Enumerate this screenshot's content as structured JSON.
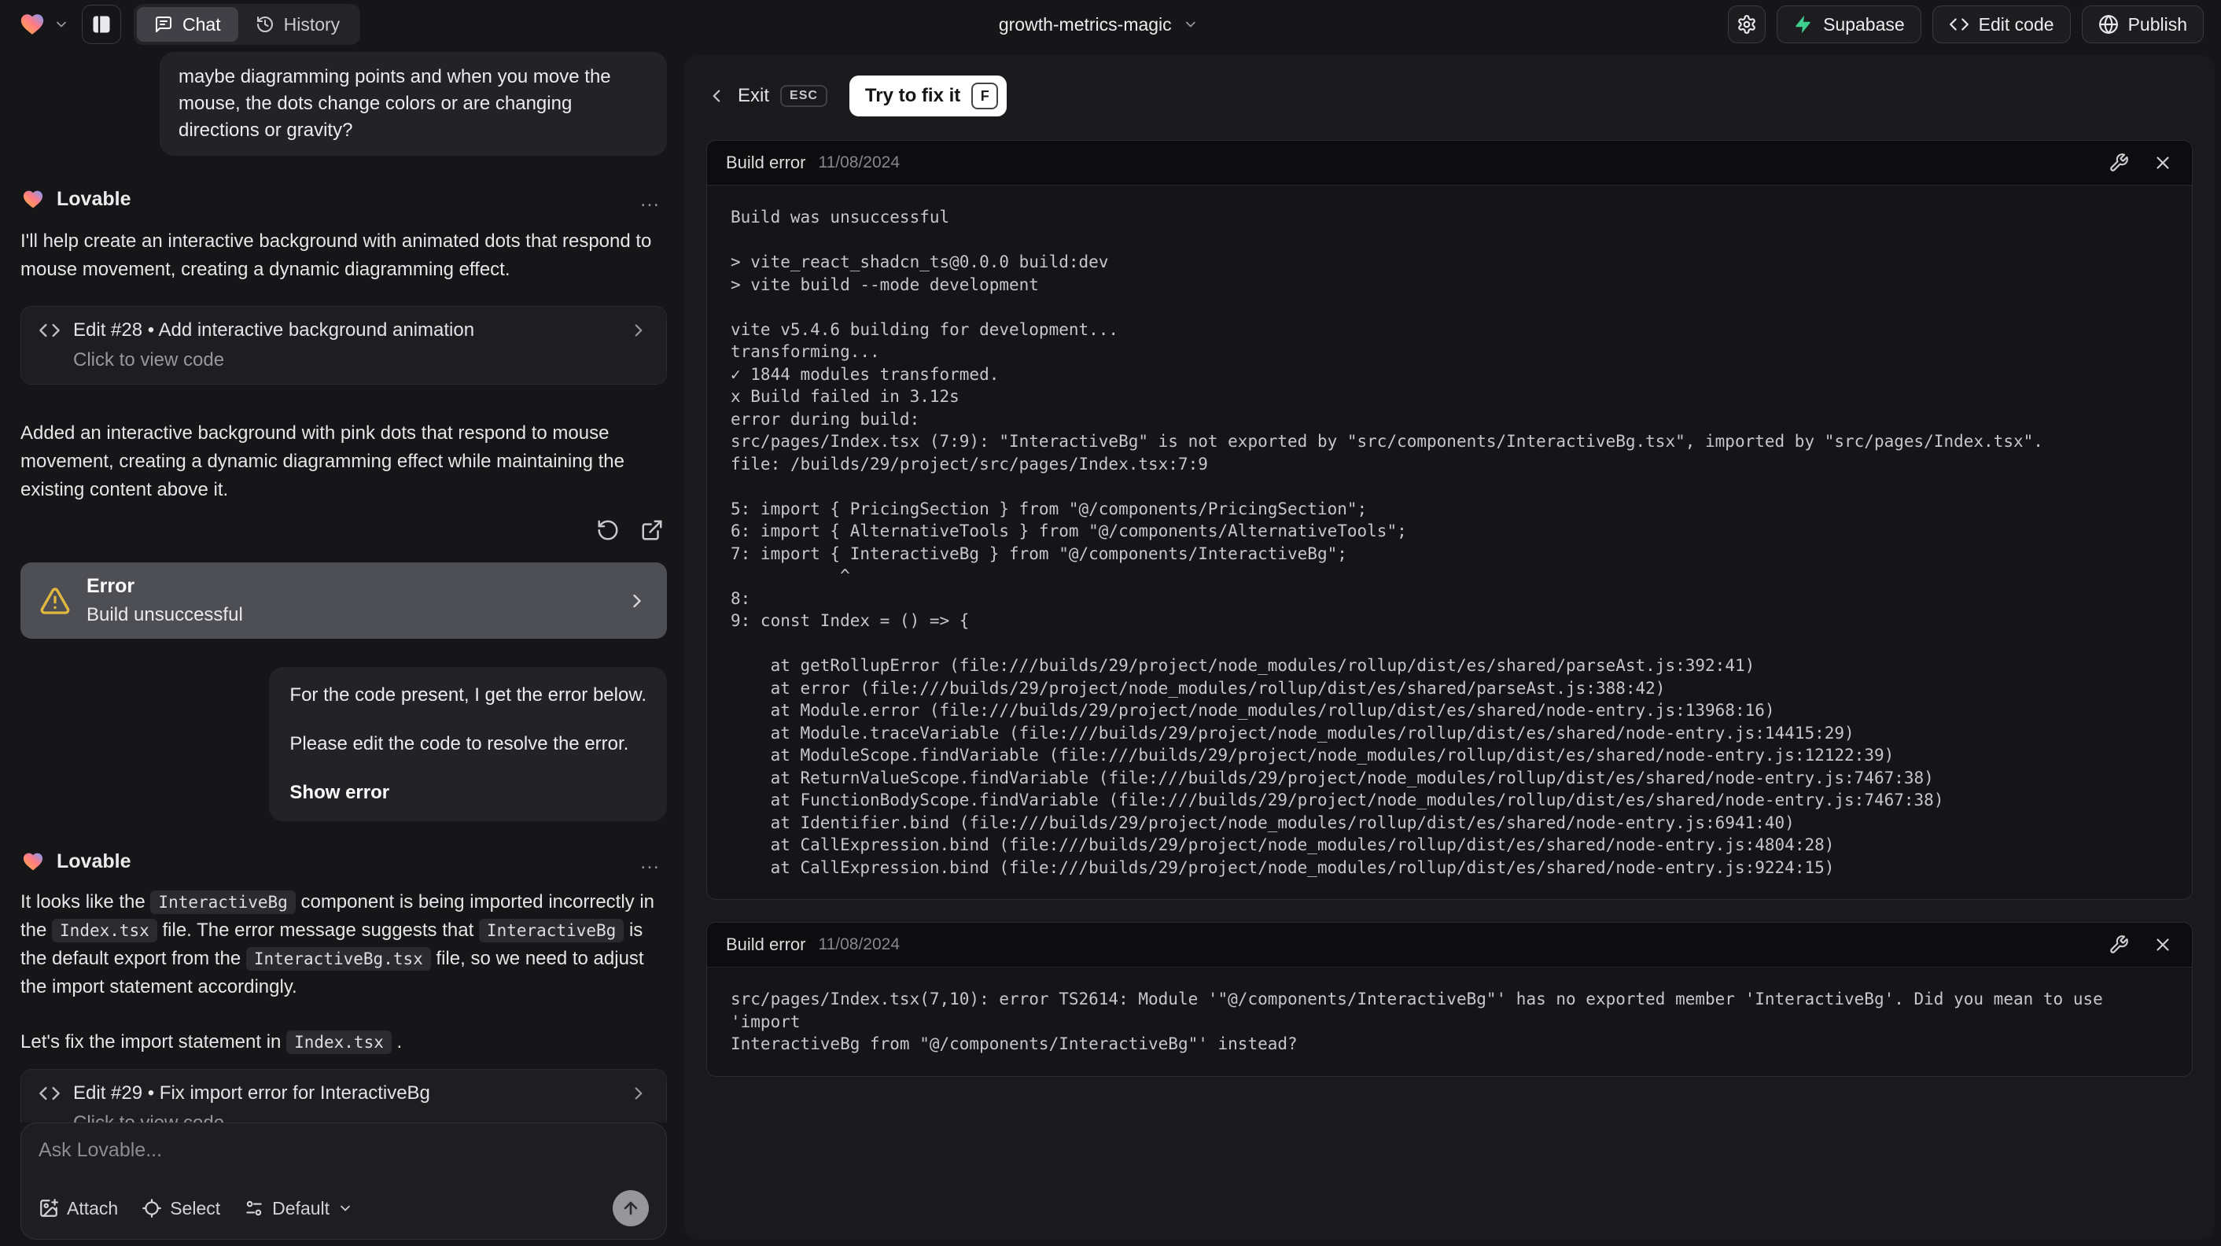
{
  "topbar": {
    "project": "growth-metrics-magic",
    "tab_chat": "Chat",
    "tab_history": "History",
    "btn_supabase": "Supabase",
    "btn_edit_code": "Edit code",
    "btn_publish": "Publish"
  },
  "colors": {
    "supabase_green": "#3ecf8e",
    "warning_amber": "#e2b93f",
    "error_card_bg": "#4e4e55",
    "try_fix_bg": "#ffffff"
  },
  "chat": {
    "assistant_name": "Lovable",
    "menu_ellipsis": "…",
    "user_msg_1": "maybe diagramming points and when you move the mouse, the dots change colors or are changing directions or gravity?",
    "assistant_msg_1": "I'll help create an interactive background with animated dots that respond to mouse movement, creating a dynamic diagramming effect.",
    "edit_card_1_title": "Edit #28 • Add interactive background animation",
    "edit_card_1_subtitle": "Click to view code",
    "assistant_msg_2": "Added an interactive background with pink dots that respond to mouse movement, creating a dynamic diagramming effect while maintaining the existing content above it.",
    "error_card_title": "Error",
    "error_card_subtitle": "Build unsuccessful",
    "user_msg_2_p1": "For the code present, I get the error below.",
    "user_msg_2_p2": "Please edit the code to resolve the error.",
    "user_msg_2_action": "Show error",
    "assistant_msg_3": {
      "s0": "It looks like the ",
      "c1": "InteractiveBg",
      "s2": " component is being imported incorrectly in the ",
      "c3": "Index.tsx",
      "s4": " file. The error message suggests that ",
      "c5": "InteractiveBg",
      "s6": " is the default export from the ",
      "c7": "InteractiveBg.tsx",
      "s8": " file, so we need to adjust the import statement accordingly."
    },
    "assistant_msg_4": {
      "s0": "Let's fix the import statement in ",
      "c1": "Index.tsx",
      "s2": " ."
    },
    "edit_card_2_title": "Edit #29 • Fix import error for InteractiveBg",
    "edit_card_2_subtitle": "Click to view code"
  },
  "composer": {
    "placeholder": "Ask Lovable...",
    "attach": "Attach",
    "select": "Select",
    "mode": "Default"
  },
  "fixbar": {
    "exit": "Exit",
    "esc": "ESC",
    "try_fix": "Try to fix it",
    "fkey": "F"
  },
  "panel1": {
    "title": "Build error",
    "date": "11/08/2024",
    "log": "Build was unsuccessful\n\n> vite_react_shadcn_ts@0.0.0 build:dev\n> vite build --mode development\n\nvite v5.4.6 building for development...\ntransforming...\n✓ 1844 modules transformed.\nx Build failed in 3.12s\nerror during build:\nsrc/pages/Index.tsx (7:9): \"InteractiveBg\" is not exported by \"src/components/InteractiveBg.tsx\", imported by \"src/pages/Index.tsx\".\nfile: /builds/29/project/src/pages/Index.tsx:7:9\n\n5: import { PricingSection } from \"@/components/PricingSection\";\n6: import { AlternativeTools } from \"@/components/AlternativeTools\";\n7: import { InteractiveBg } from \"@/components/InteractiveBg\";\n           ^\n8:\n9: const Index = () => {\n\n    at getRollupError (file:///builds/29/project/node_modules/rollup/dist/es/shared/parseAst.js:392:41)\n    at error (file:///builds/29/project/node_modules/rollup/dist/es/shared/parseAst.js:388:42)\n    at Module.error (file:///builds/29/project/node_modules/rollup/dist/es/shared/node-entry.js:13968:16)\n    at Module.traceVariable (file:///builds/29/project/node_modules/rollup/dist/es/shared/node-entry.js:14415:29)\n    at ModuleScope.findVariable (file:///builds/29/project/node_modules/rollup/dist/es/shared/node-entry.js:12122:39)\n    at ReturnValueScope.findVariable (file:///builds/29/project/node_modules/rollup/dist/es/shared/node-entry.js:7467:38)\n    at FunctionBodyScope.findVariable (file:///builds/29/project/node_modules/rollup/dist/es/shared/node-entry.js:7467:38)\n    at Identifier.bind (file:///builds/29/project/node_modules/rollup/dist/es/shared/node-entry.js:6941:40)\n    at CallExpression.bind (file:///builds/29/project/node_modules/rollup/dist/es/shared/node-entry.js:4804:28)\n    at CallExpression.bind (file:///builds/29/project/node_modules/rollup/dist/es/shared/node-entry.js:9224:15)"
  },
  "panel2": {
    "title": "Build error",
    "date": "11/08/2024",
    "log": "src/pages/Index.tsx(7,10): error TS2614: Module '\"@/components/InteractiveBg\"' has no exported member 'InteractiveBg'. Did you mean to use 'import\nInteractiveBg from \"@/components/InteractiveBg\"' instead?"
  }
}
